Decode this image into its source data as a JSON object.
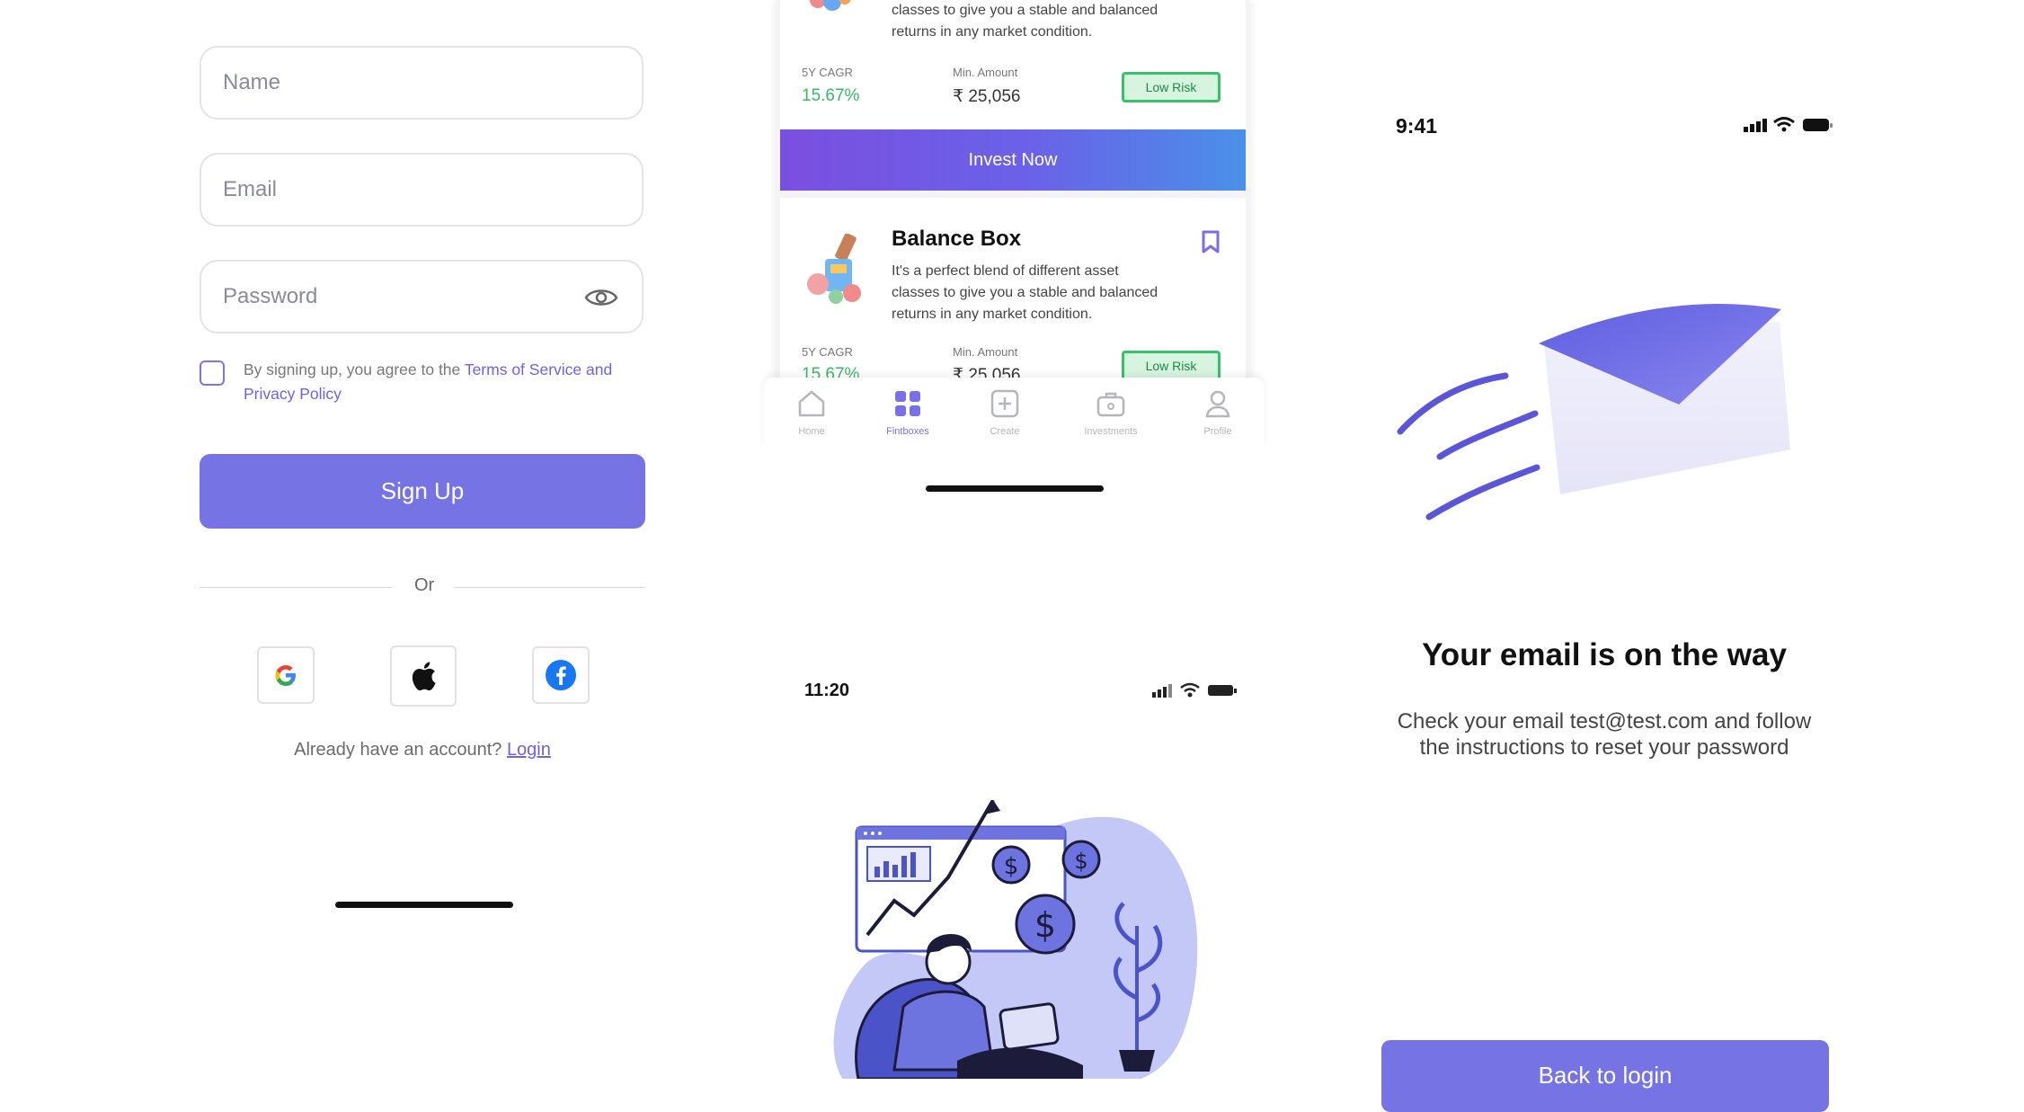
{
  "signup": {
    "name_placeholder": "Name",
    "email_placeholder": "Email",
    "password_placeholder": "Password",
    "terms_prefix": "By signing up, you agree to the ",
    "terms_link_1": "Terms of Service and",
    "terms_link_2": "Privacy Policy",
    "signup_label": "Sign Up",
    "or_label": "Or",
    "already_text": "Already have an account? ",
    "login_label": "Login",
    "social": [
      "google-icon",
      "apple-icon",
      "facebook-icon"
    ],
    "accent_color": "#7673e4"
  },
  "invest": {
    "card1": {
      "desc_line1": "classes to give you a stable and balanced",
      "desc_line2": "returns in any market condition.",
      "cagr_label": "5Y CAGR",
      "cagr_value": "15.67%",
      "min_label": "Min. Amount",
      "min_value": "₹ 25,056",
      "risk": "Low Risk"
    },
    "invest_now": "Invest Now",
    "card2": {
      "title": "Balance Box",
      "desc_line1": "It's a perfect blend of different asset",
      "desc_line2": "classes to give you a stable and balanced",
      "desc_line3": "returns in any market condition.",
      "cagr_label": "5Y CAGR",
      "cagr_value": "15.67%",
      "min_label": "Min. Amount",
      "min_value": "₹ 25,056",
      "risk": "Low Risk"
    },
    "tabs": [
      "Home",
      "Fintboxes",
      "Create",
      "Investments",
      "Profile"
    ],
    "active_tab": "Fintboxes",
    "status_time": "11:20",
    "positive_color": "#38b768"
  },
  "email_sent": {
    "status_time": "9:41",
    "headline": "Your email is on the way",
    "sub_line1": "Check your email test@test.com and follow",
    "sub_line2": "the instructions to reset your password",
    "back_label": "Back to login"
  }
}
